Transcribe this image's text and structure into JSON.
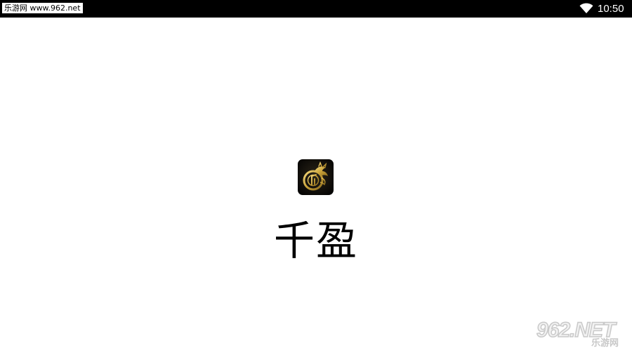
{
  "status_bar": {
    "watermark": "乐游网 www.962.net",
    "time": "10:50",
    "wifi_icon": "wifi-icon"
  },
  "splash": {
    "app_icon": "dragon-logo-icon",
    "app_name": "千盈"
  },
  "corner_watermark": {
    "brand": "962.NET",
    "sub": "乐游网"
  },
  "colors": {
    "status_bar_bg": "#000000",
    "background": "#ffffff",
    "icon_gold": "#c9a23a"
  }
}
